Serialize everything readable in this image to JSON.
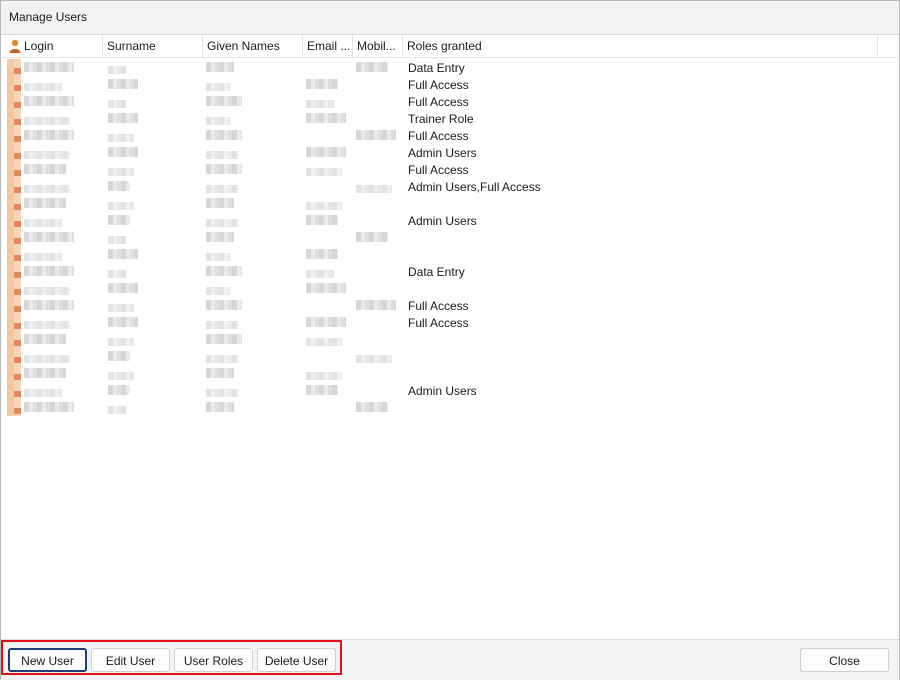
{
  "window": {
    "title": "Manage Users"
  },
  "columns": [
    {
      "key": "login",
      "label": "Login"
    },
    {
      "key": "surname",
      "label": "Surname"
    },
    {
      "key": "given",
      "label": "Given Names"
    },
    {
      "key": "email",
      "label": "Email ..."
    },
    {
      "key": "mobile",
      "label": "Mobil..."
    },
    {
      "key": "roles",
      "label": "Roles granted"
    }
  ],
  "rows": [
    {
      "roles": "Data Entry"
    },
    {
      "roles": "Full Access"
    },
    {
      "roles": "Full Access"
    },
    {
      "roles": "Trainer Role"
    },
    {
      "roles": "Full Access"
    },
    {
      "roles": "Admin Users"
    },
    {
      "roles": "Full Access"
    },
    {
      "roles": "Admin Users,Full Access"
    },
    {
      "roles": ""
    },
    {
      "roles": "Admin Users"
    },
    {
      "roles": ""
    },
    {
      "roles": ""
    },
    {
      "roles": "Data Entry"
    },
    {
      "roles": ""
    },
    {
      "roles": "Full Access"
    },
    {
      "roles": "Full Access"
    },
    {
      "roles": ""
    },
    {
      "roles": ""
    },
    {
      "roles": ""
    },
    {
      "roles": "Admin Users"
    },
    {
      "roles": ""
    }
  ],
  "buttons": {
    "new_user": "New User",
    "edit_user": "Edit User",
    "user_roles": "User Roles",
    "delete_user": "Delete User",
    "close": "Close"
  },
  "icons": {
    "login_header_icon": "user-icon"
  },
  "colors": {
    "highlight_outline": "#e0101a",
    "primary_border": "#1f3f7a"
  }
}
